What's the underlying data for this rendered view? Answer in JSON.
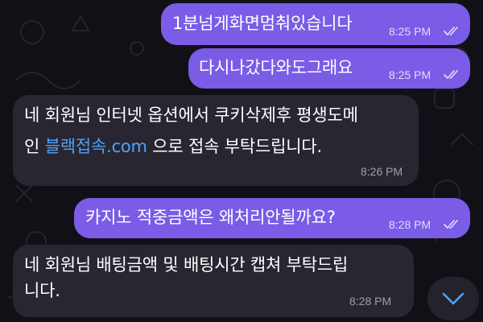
{
  "chat": {
    "messages": [
      {
        "id": "m1",
        "direction": "outgoing",
        "text": "1분넘게화면멈춰있습니다",
        "time": "8:25 PM",
        "status": "read"
      },
      {
        "id": "m2",
        "direction": "outgoing",
        "text": "다시나갔다와도그래요",
        "time": "8:25 PM",
        "status": "read"
      },
      {
        "id": "m3",
        "direction": "incoming",
        "line1": "네 회원님 인터넷 옵션에서 쿠키삭제후 평생도메",
        "line2_prefix": "인 ",
        "link": "블랙접속.com",
        "line2_suffix": " 으로 접속 부탁드립니다.",
        "time": "8:26 PM"
      },
      {
        "id": "m4",
        "direction": "outgoing",
        "text": "카지노 적중금액은 왜처리안될까요?",
        "time": "8:28 PM",
        "status": "read"
      },
      {
        "id": "m5",
        "direction": "incoming",
        "line1": "네 회원님 배팅금액 및 배팅시간 캡쳐 부탁드립",
        "line2": "니다.",
        "time": "8:28 PM"
      }
    ]
  },
  "colors": {
    "background": "#121017",
    "outgoing_bubble": "#7a5ce6",
    "incoming_bubble": "#292631",
    "link": "#4da3ff",
    "scroll_button": "#24222b"
  },
  "icons": {
    "read_receipt": "double-check-icon",
    "scroll_down": "chevron-down-icon"
  }
}
